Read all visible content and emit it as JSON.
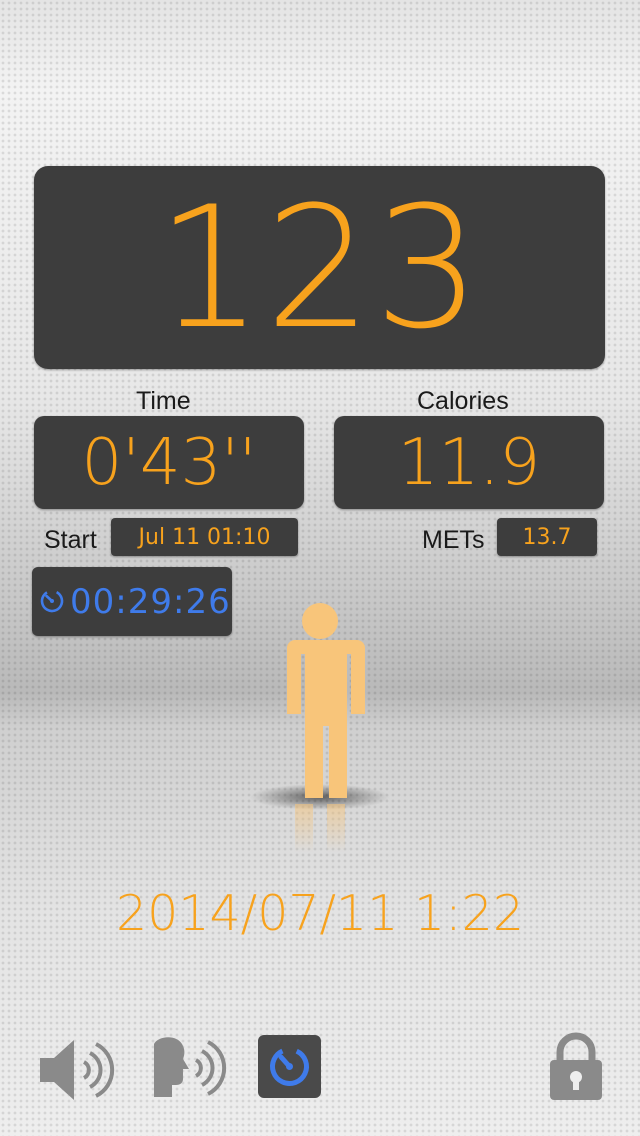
{
  "counter": {
    "value": "123"
  },
  "time": {
    "label": "Time",
    "value": "0'43''"
  },
  "calories": {
    "label": "Calories",
    "value": "11.9"
  },
  "start": {
    "label": "Start",
    "value": "Jul 11 01:10"
  },
  "mets": {
    "label": "METs",
    "value": "13.7"
  },
  "timer": {
    "value": "00:29:26",
    "icon": "timer-icon"
  },
  "figure": {
    "icon": "standing-person-icon"
  },
  "datetime": {
    "value": "2014/07/11 1:22"
  },
  "toolbar": {
    "items": [
      {
        "name": "sound",
        "icon": "speaker-icon"
      },
      {
        "name": "voice",
        "icon": "voice-guide-icon"
      },
      {
        "name": "stopwatch",
        "icon": "stopwatch-icon",
        "active": true
      },
      {
        "name": "lock",
        "icon": "lock-icon"
      }
    ]
  },
  "colors": {
    "accent": "#f7a21d",
    "panel": "#3d3d3d",
    "timer_blue": "#3f7bea",
    "figure": "#f8c57a"
  }
}
